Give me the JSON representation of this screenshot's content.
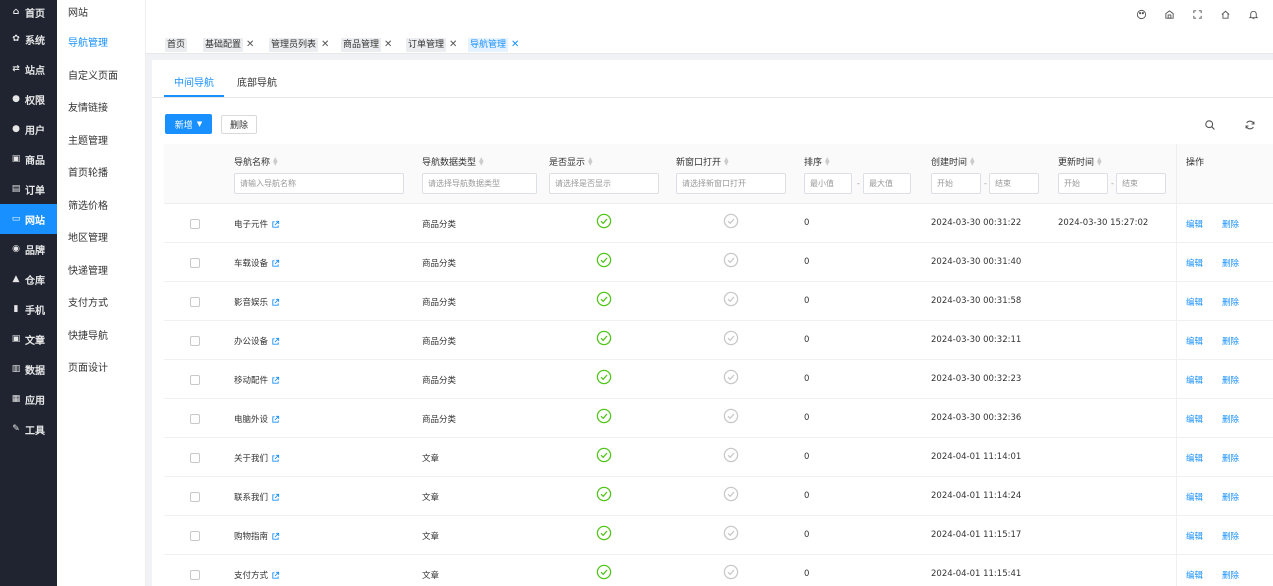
{
  "rail": [
    {
      "label": "首页",
      "icon": "home-icon",
      "glyph": "⌂"
    },
    {
      "label": "系统",
      "icon": "gear-icon",
      "glyph": "✿"
    },
    {
      "label": "站点",
      "icon": "swap-icon",
      "glyph": "⇄"
    },
    {
      "label": "权限",
      "icon": "user-lock-icon",
      "glyph": "●"
    },
    {
      "label": "用户",
      "icon": "user-icon",
      "glyph": "●"
    },
    {
      "label": "商品",
      "icon": "envelope-icon",
      "glyph": "▣"
    },
    {
      "label": "订单",
      "icon": "order-icon",
      "glyph": "▤"
    },
    {
      "label": "网站",
      "icon": "monitor-icon",
      "glyph": "▭",
      "active": true
    },
    {
      "label": "品牌",
      "icon": "brand-icon",
      "glyph": "◉"
    },
    {
      "label": "仓库",
      "icon": "warehouse-icon",
      "glyph": "▲"
    },
    {
      "label": "手机",
      "icon": "phone-icon",
      "glyph": "▮"
    },
    {
      "label": "文章",
      "icon": "article-icon",
      "glyph": "▣"
    },
    {
      "label": "数据",
      "icon": "bar-chart-icon",
      "glyph": "▥"
    },
    {
      "label": "应用",
      "icon": "apps-icon",
      "glyph": "▦"
    },
    {
      "label": "工具",
      "icon": "wrench-icon",
      "glyph": "✎"
    }
  ],
  "submenu": {
    "title": "网站",
    "items": [
      {
        "label": "导航管理",
        "active": true
      },
      {
        "label": "自定义页面"
      },
      {
        "label": "友情链接"
      },
      {
        "label": "主题管理"
      },
      {
        "label": "首页轮播"
      },
      {
        "label": "筛选价格"
      },
      {
        "label": "地区管理"
      },
      {
        "label": "快递管理"
      },
      {
        "label": "支付方式"
      },
      {
        "label": "快捷导航"
      },
      {
        "label": "页面设计"
      }
    ]
  },
  "tags": [
    {
      "label": "首页",
      "closable": false
    },
    {
      "label": "基础配置",
      "closable": true
    },
    {
      "label": "管理员列表",
      "closable": true
    },
    {
      "label": "商品管理",
      "closable": true
    },
    {
      "label": "订单管理",
      "closable": true
    },
    {
      "label": "导航管理",
      "closable": true,
      "active": true
    }
  ],
  "tag_close": "✕",
  "tabs": [
    {
      "label": "中间导航",
      "active": true
    },
    {
      "label": "底部导航"
    }
  ],
  "toolbar": {
    "add_label": "新增",
    "delete_label": "删除"
  },
  "columns": {
    "name": "导航名称",
    "data_type": "导航数据类型",
    "is_show": "是否显示",
    "new_window": "新窗口打开",
    "sort": "排序",
    "created": "创建时间",
    "updated": "更新时间",
    "ops": "操作"
  },
  "filters": {
    "name_ph": "请输入导航名称",
    "type_ph": "请选择导航数据类型",
    "show_ph": "请选择是否显示",
    "window_ph": "请选择新窗口打开",
    "min_ph": "最小值",
    "max_ph": "最大值",
    "start_ph": "开始",
    "end_ph": "结束",
    "sep": "-"
  },
  "row_actions": {
    "edit": "编辑",
    "delete": "删除"
  },
  "rows": [
    {
      "name": "电子元件",
      "type": "商品分类",
      "show": true,
      "new_window": false,
      "sort": "0",
      "created": "2024-03-30 00:31:22",
      "updated": "2024-03-30 15:27:02"
    },
    {
      "name": "车载设备",
      "type": "商品分类",
      "show": true,
      "new_window": false,
      "sort": "0",
      "created": "2024-03-30 00:31:40",
      "updated": ""
    },
    {
      "name": "影音娱乐",
      "type": "商品分类",
      "show": true,
      "new_window": false,
      "sort": "0",
      "created": "2024-03-30 00:31:58",
      "updated": ""
    },
    {
      "name": "办公设备",
      "type": "商品分类",
      "show": true,
      "new_window": false,
      "sort": "0",
      "created": "2024-03-30 00:32:11",
      "updated": ""
    },
    {
      "name": "移动配件",
      "type": "商品分类",
      "show": true,
      "new_window": false,
      "sort": "0",
      "created": "2024-03-30 00:32:23",
      "updated": ""
    },
    {
      "name": "电脑外设",
      "type": "商品分类",
      "show": true,
      "new_window": false,
      "sort": "0",
      "created": "2024-03-30 00:32:36",
      "updated": ""
    },
    {
      "name": "关于我们",
      "type": "文章",
      "show": true,
      "new_window": false,
      "sort": "0",
      "created": "2024-04-01 11:14:01",
      "updated": ""
    },
    {
      "name": "联系我们",
      "type": "文章",
      "show": true,
      "new_window": false,
      "sort": "0",
      "created": "2024-04-01 11:14:24",
      "updated": ""
    },
    {
      "name": "购物指南",
      "type": "文章",
      "show": true,
      "new_window": false,
      "sort": "0",
      "created": "2024-04-01 11:15:17",
      "updated": ""
    },
    {
      "name": "支付方式",
      "type": "文章",
      "show": true,
      "new_window": false,
      "sort": "0",
      "created": "2024-04-01 11:15:41",
      "updated": ""
    }
  ],
  "colors": {
    "primary": "#1890ff",
    "rail_bg": "#1f2430",
    "check_on": "#52c41a",
    "check_off": "#c8c8c8"
  }
}
